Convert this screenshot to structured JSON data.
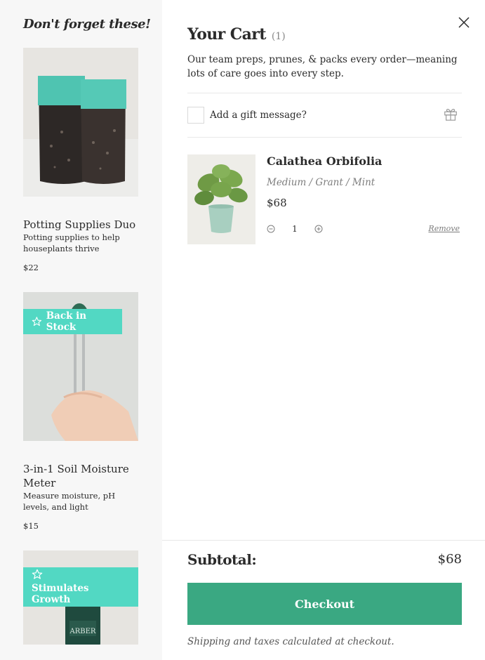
{
  "upsell": {
    "title": "Don't forget these!",
    "products": [
      {
        "name": "Potting Supplies Duo",
        "description": "Potting supplies to help houseplants thrive",
        "price": "$22",
        "badge": ""
      },
      {
        "name": "3-in-1 Soil Moisture Meter",
        "description": "Measure moisture, pH levels, and light",
        "price": "$15",
        "badge": "Back in Stock"
      },
      {
        "name": "",
        "description": "",
        "price": "",
        "badge": "Stimulates Growth",
        "label_text": "ARBER"
      }
    ]
  },
  "cart": {
    "title": "Your Cart",
    "count": "(1)",
    "intro": "Our team preps, prunes, & packs every order—meaning lots of care goes into every step.",
    "gift_label": "Add a gift message?",
    "items": [
      {
        "name": "Calathea Orbifolia",
        "variant": "Medium / Grant / Mint",
        "price": "$68",
        "quantity": "1",
        "remove_label": "Remove"
      }
    ],
    "subtotal_label": "Subtotal:",
    "subtotal_value": "$68",
    "checkout_label": "Checkout",
    "shipping_note": "Shipping and taxes calculated at checkout."
  },
  "colors": {
    "accent_teal": "#52d8c3",
    "checkout_green": "#3aa882",
    "panel_bg": "#f7f7f7"
  },
  "icons": [
    "close-icon",
    "gift-icon",
    "minus-circle-icon",
    "plus-circle-icon",
    "star-outline-icon"
  ]
}
